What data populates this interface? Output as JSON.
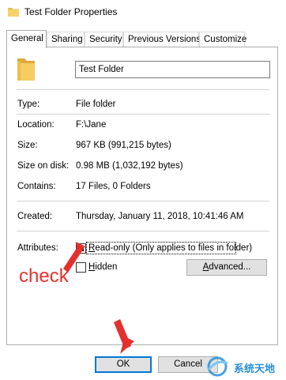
{
  "window": {
    "title": "Test Folder Properties"
  },
  "tabs": [
    {
      "label": "General",
      "active": true
    },
    {
      "label": "Sharing"
    },
    {
      "label": "Security"
    },
    {
      "label": "Previous Versions"
    },
    {
      "label": "Customize"
    }
  ],
  "general": {
    "name_value": "Test Folder",
    "type": {
      "label": "Type:",
      "value": "File folder"
    },
    "location": {
      "label": "Location:",
      "value": "F:\\Jane"
    },
    "size": {
      "label": "Size:",
      "value": "967 KB (991,215 bytes)"
    },
    "size_on_disk": {
      "label": "Size on disk:",
      "value": "0.98 MB (1,032,192 bytes)"
    },
    "contains": {
      "label": "Contains:",
      "value": "17 Files, 0 Folders"
    },
    "created": {
      "label": "Created:",
      "value": "Thursday, January 11, 2018, 10:41:46 AM"
    },
    "attributes": {
      "label": "Attributes:",
      "readonly_prefix": "R",
      "readonly_rest": "ead-only (Only applies to files in folder)",
      "readonly_checked": true,
      "hidden_prefix": "H",
      "hidden_rest": "idden",
      "hidden_checked": false,
      "advanced_prefix": "A",
      "advanced_rest": "dvanced..."
    }
  },
  "footer": {
    "ok_label": "OK",
    "cancel_label": "Cancel"
  },
  "annotation": {
    "check_text": "check",
    "color": "#e3312d"
  },
  "watermark": {
    "text": "系统天地"
  },
  "colors": {
    "focus_blue": "#0078d7",
    "folder_yellow": "#f2c94c",
    "button_face": "#e1e1e1"
  }
}
